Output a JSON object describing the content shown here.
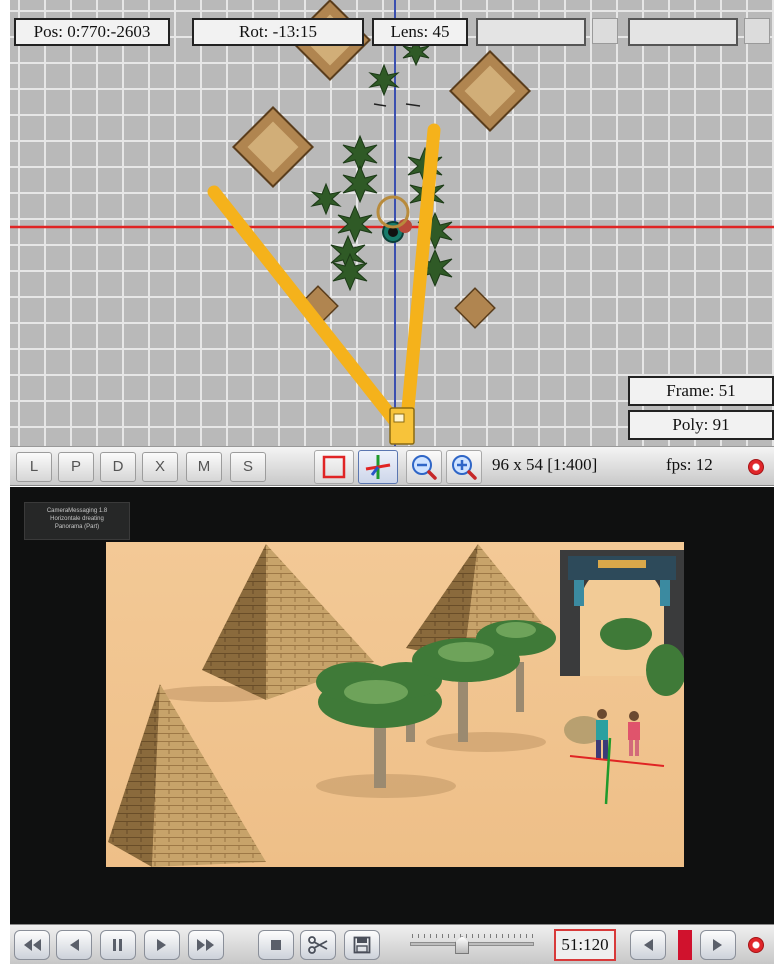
{
  "top_view": {
    "pos": "Pos: 0:770:-2603",
    "rot": "Rot: -13:15",
    "lens": "Lens: 45",
    "frame": "Frame: 51",
    "poly": "Poly: 91"
  },
  "toolbar": {
    "view_buttons": [
      "L",
      "P",
      "D",
      "X",
      "M",
      "S"
    ],
    "resolution": "96 x 54 [1:400]",
    "fps": "fps: 12",
    "icons": {
      "select": "square-select-icon",
      "axis": "axis-gizmo-icon",
      "zoom_out": "zoom-out-icon",
      "zoom_in": "zoom-in-icon",
      "record": "record-icon"
    }
  },
  "camera_view": {
    "overlay_lines": [
      "CameraMessaging 1.8",
      "Horizontale dreating",
      "Panorama (Part)"
    ]
  },
  "transport": {
    "frame_counter": "51:120",
    "slider_position": 0.42,
    "icons": [
      "rewind-icon",
      "step-back-icon",
      "pause-icon",
      "play-icon",
      "fast-forward-icon",
      "stop-icon",
      "scissors-icon",
      "save-icon",
      "prev-frame-icon",
      "next-frame-icon",
      "record-icon"
    ]
  },
  "colors": {
    "grid_bg": "#b9b9b9",
    "grid_line": "#e6e6e6",
    "x_axis": "#e02424",
    "y_axis": "#3a4fb0",
    "frustum": "#f5b21b",
    "sand": "#f1c793",
    "viewport_bg": "#0f1010",
    "frame_counter_border": "#d83a3a"
  }
}
